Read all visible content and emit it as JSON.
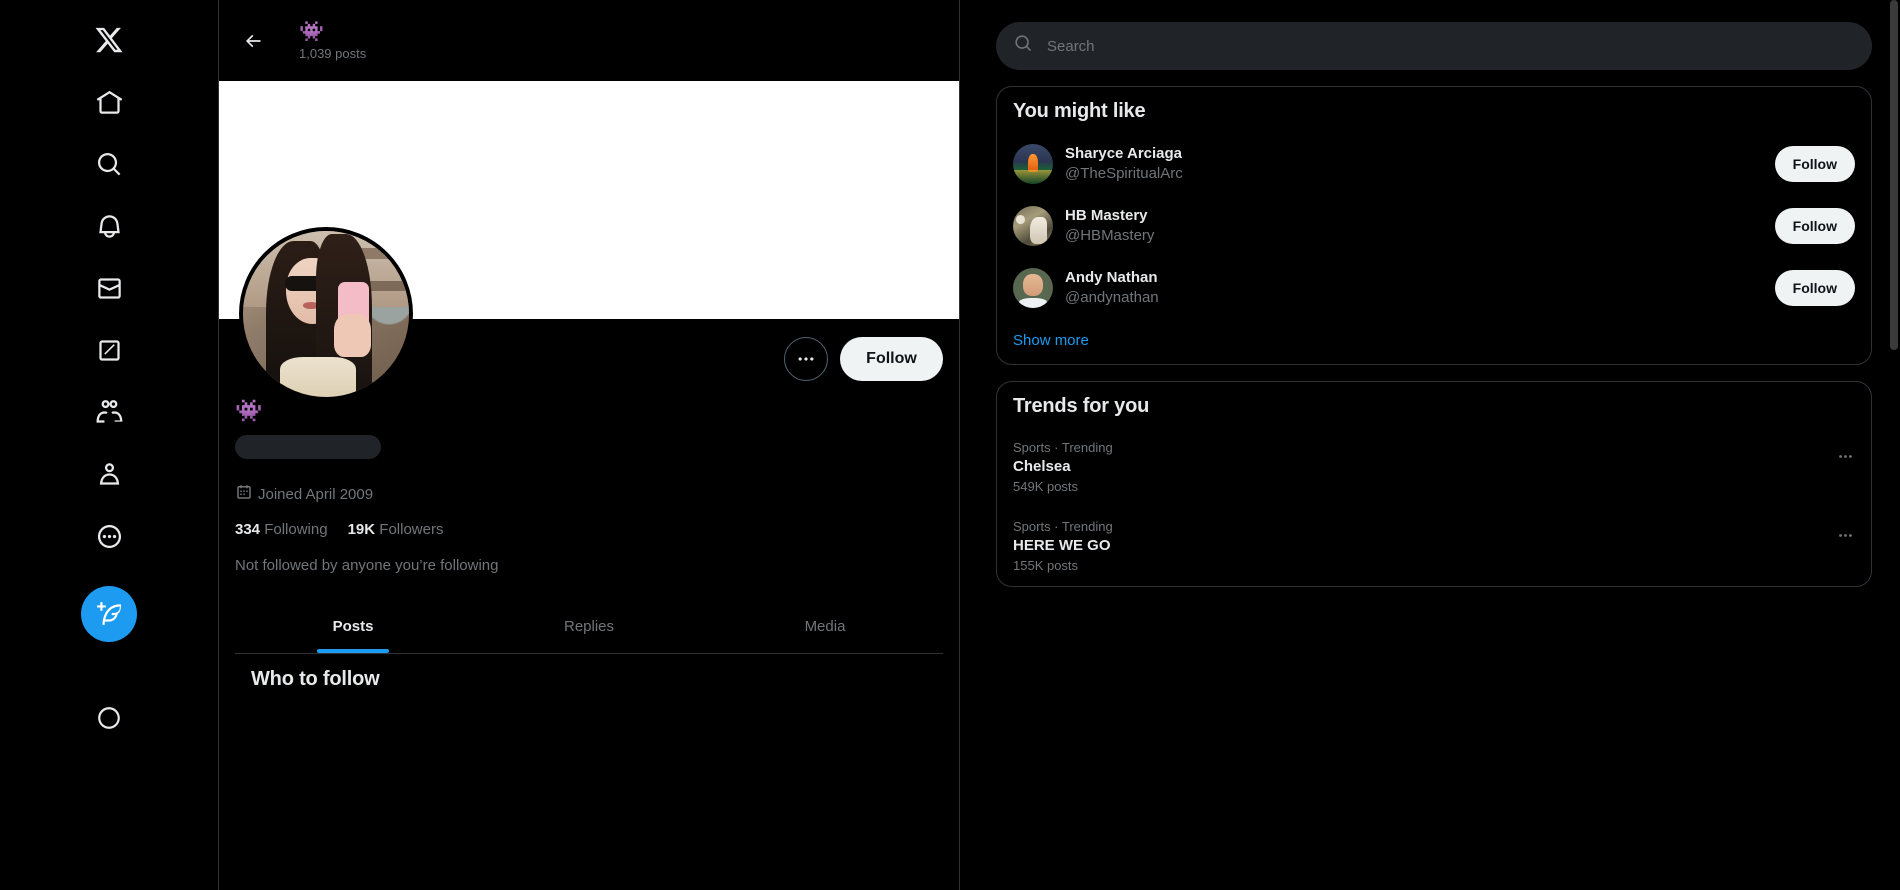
{
  "left_nav": {
    "items": [
      {
        "name": "x-logo",
        "label": "X"
      },
      {
        "name": "home",
        "label": "Home"
      },
      {
        "name": "explore",
        "label": "Explore"
      },
      {
        "name": "notifications",
        "label": "Notifications"
      },
      {
        "name": "messages",
        "label": "Messages"
      },
      {
        "name": "grok",
        "label": "Grok"
      },
      {
        "name": "communities",
        "label": "Communities"
      },
      {
        "name": "profile",
        "label": "Profile"
      },
      {
        "name": "more",
        "label": "More"
      }
    ],
    "compose_label": "Post"
  },
  "profile_header": {
    "name": "👾",
    "posts_count": "1,039 posts"
  },
  "profile": {
    "display_name": "👾",
    "handle_placeholder_loading": true,
    "joined": "Joined April 2009",
    "following_count": "334",
    "following_label": "Following",
    "followers_count": "19K",
    "followers_label": "Followers",
    "not_followed_text": "Not followed by anyone you’re following",
    "follow_button": "Follow",
    "more_button": "More"
  },
  "tabs": [
    {
      "label": "Posts",
      "active": true
    },
    {
      "label": "Replies",
      "active": false
    },
    {
      "label": "Media",
      "active": false
    }
  ],
  "feed": {
    "who_to_follow_title": "Who to follow"
  },
  "search": {
    "placeholder": "Search",
    "value": ""
  },
  "you_might_like": {
    "title": "You might like",
    "show_more": "Show more",
    "accounts": [
      {
        "name": "Sharyce Arciaga",
        "handle": "@TheSpiritualArc",
        "follow_label": "Follow",
        "avatar": "meditation-sunset-avatar"
      },
      {
        "name": "HB Mastery",
        "handle": "@HBMastery",
        "follow_label": "Follow",
        "avatar": "dog-rocks-avatar"
      },
      {
        "name": "Andy Nathan",
        "handle": "@andynathan",
        "follow_label": "Follow",
        "avatar": "man-portrait-avatar"
      }
    ]
  },
  "trends": {
    "title": "Trends for you",
    "items": [
      {
        "category": "Sports · Trending",
        "name": "Chelsea",
        "count": "549K posts"
      },
      {
        "category": "Sports · Trending",
        "name": "HERE WE GO",
        "count": "155K posts"
      }
    ]
  },
  "colors": {
    "accent": "#1d9bf0",
    "background": "#000000",
    "text_primary": "#e7e9ea",
    "text_secondary": "#71767b",
    "border": "#2f3336",
    "button_light": "#eff3f4",
    "banner": "#ffffff"
  }
}
